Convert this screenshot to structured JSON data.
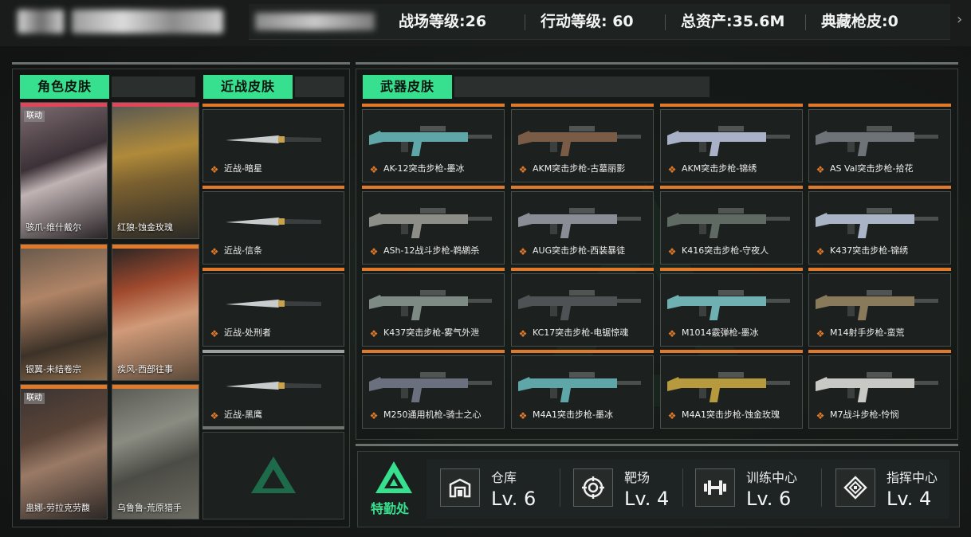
{
  "topbar": {
    "stats": [
      {
        "label": "战场等级:26"
      },
      {
        "label": "行动等级: 60"
      },
      {
        "label": "总资产:35.6M"
      },
      {
        "label": "典藏枪皮:0"
      }
    ],
    "chevron": "›"
  },
  "sections": {
    "character": "角色皮肤",
    "melee": "近战皮肤",
    "weapon": "武器皮肤"
  },
  "character_skins": [
    {
      "name": "骇爪-维什戴尔",
      "tag": "联动",
      "top_color": "#e0465a"
    },
    {
      "name": "红狼-蚀金玫瑰",
      "tag": "",
      "top_color": "#e0465a"
    },
    {
      "name": "银翼-未结卷宗",
      "tag": "",
      "top_color": "#e07a2a"
    },
    {
      "name": "疾风-西部往事",
      "tag": "",
      "top_color": "#e07a2a"
    },
    {
      "name": "蛊娜-劳拉克劳馥",
      "tag": "联动",
      "top_color": "#e07a2a"
    },
    {
      "name": "乌鲁鲁-荒原猎手",
      "tag": "",
      "top_color": "#e07a2a"
    }
  ],
  "melee_skins": [
    {
      "name": "近战-暗星",
      "top_color": "#e07a2a"
    },
    {
      "name": "近战-信条",
      "top_color": "#e07a2a"
    },
    {
      "name": "近战-处刑者",
      "top_color": "#e07a2a"
    },
    {
      "name": "近战-黑鹰",
      "top_color": "#9a9fa0"
    }
  ],
  "weapon_skins": [
    {
      "name": "AK-12突击步枪-墨冰",
      "color": "#5ea6a8"
    },
    {
      "name": "AKM突击步枪-古墓丽影",
      "color": "#7a5b46"
    },
    {
      "name": "AKM突击步枪-锦绣",
      "color": "#a9b1c8"
    },
    {
      "name": "AS Val突击步枪-拾花",
      "color": "#6e7378"
    },
    {
      "name": "ASh-12战斗步枪-鹈鹕杀",
      "color": "#8d8e88"
    },
    {
      "name": "AUG突击步枪-西装暴徒",
      "color": "#8a8c96"
    },
    {
      "name": "K416突击步枪-守夜人",
      "color": "#5f6a62"
    },
    {
      "name": "K437突击步枪-锦绣",
      "color": "#a9b4c6"
    },
    {
      "name": "K437突击步枪-雾气外泄",
      "color": "#7e8a84"
    },
    {
      "name": "KC17突击步枪-电锯惊魂",
      "color": "#4e5254"
    },
    {
      "name": "M1014霰弹枪-墨冰",
      "color": "#6fb1b2"
    },
    {
      "name": "M14射手步枪-蛮荒",
      "color": "#8a7a5c"
    },
    {
      "name": "M250通用机枪-骑士之心",
      "color": "#6a707e"
    },
    {
      "name": "M4A1突击步枪-墨冰",
      "color": "#5fa6a8"
    },
    {
      "name": "M4A1突击步枪-蚀金玫瑰",
      "color": "#b89a3e"
    },
    {
      "name": "M7战斗步枪-怜悯",
      "color": "#c8c8c4"
    }
  ],
  "facilities": {
    "title": "特勤处",
    "items": [
      {
        "name": "仓库",
        "level": "Lv. 6",
        "icon": "warehouse-icon"
      },
      {
        "name": "靶场",
        "level": "Lv. 4",
        "icon": "target-icon"
      },
      {
        "name": "训练中心",
        "level": "Lv. 6",
        "icon": "dumbbell-icon"
      },
      {
        "name": "指挥中心",
        "level": "Lv. 4",
        "icon": "command-icon"
      }
    ]
  },
  "colors": {
    "accent_green": "#36e08e",
    "accent_orange": "#e07a2a",
    "accent_red": "#e0465a"
  }
}
